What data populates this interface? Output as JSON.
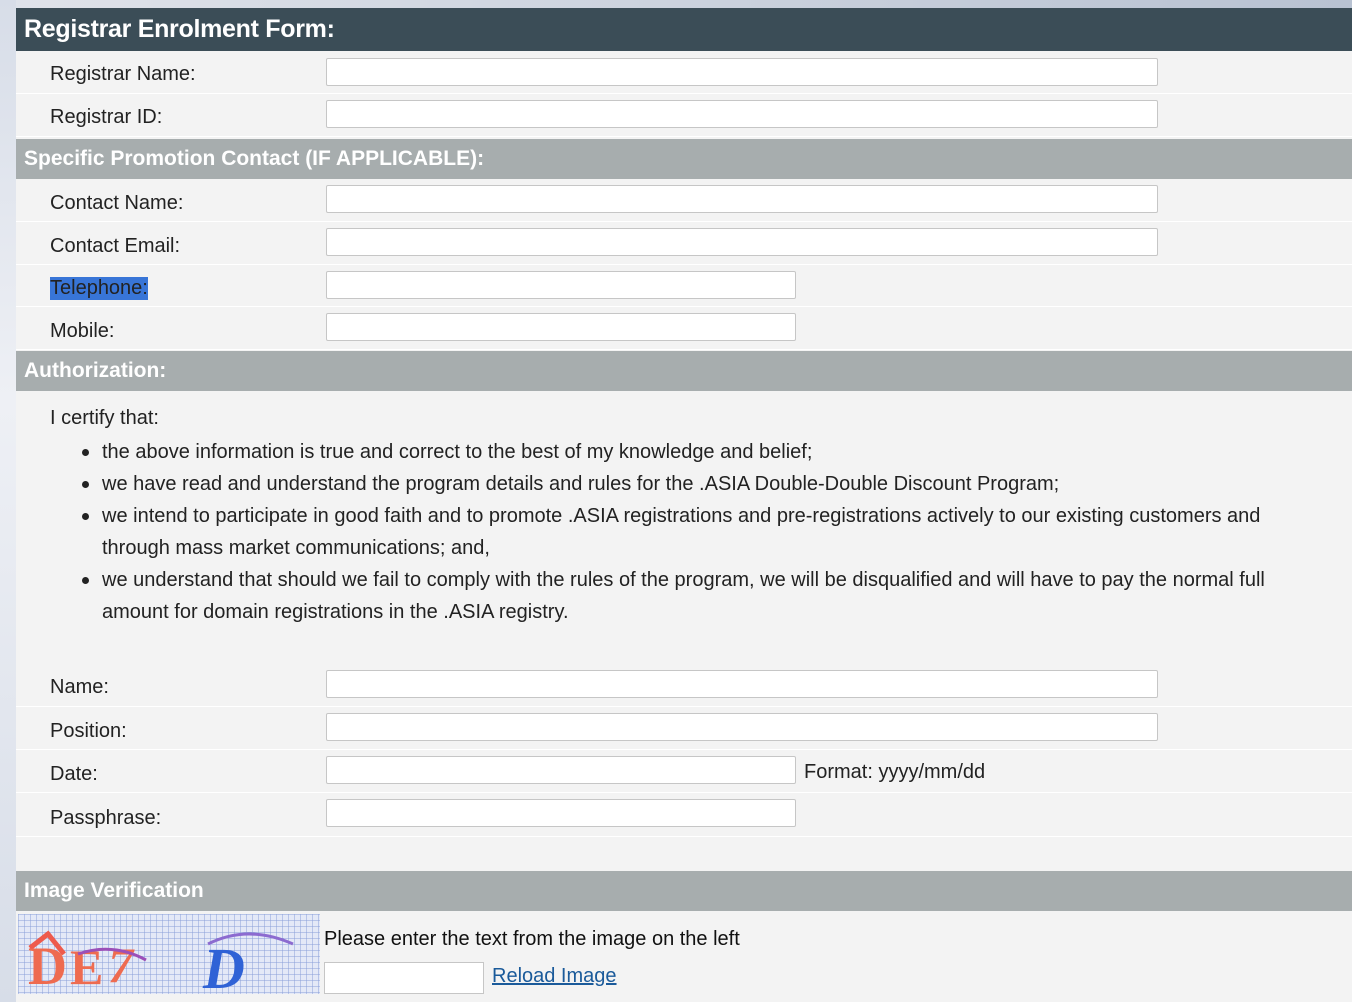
{
  "form": {
    "title": "Registrar Enrolment Form:",
    "registrar_name_label": "Registrar Name:",
    "registrar_id_label": "Registrar ID:",
    "contact_section_title": "Specific Promotion Contact (IF APPLICABLE):",
    "contact_name_label": "Contact Name:",
    "contact_email_label": "Contact Email:",
    "telephone_label": "Telephone:",
    "mobile_label": "Mobile:",
    "authorization_title": "Authorization:",
    "certify_intro": "I certify that:",
    "certify_items": [
      "the above information is true and correct to the best of my knowledge and belief;",
      "we have read and understand the program details and rules for the .ASIA Double-Double Discount Program;",
      "we intend to participate in good faith and to promote .ASIA registrations and pre-registrations actively to our existing customers and through mass market communications; and,",
      "we understand that should we fail to comply with the rules of the program, we will be disqualified and will have to pay the normal full amount for domain registrations in the .ASIA registry."
    ],
    "name_label": "Name:",
    "position_label": "Position:",
    "date_label": "Date:",
    "date_format_hint": "Format: yyyy/mm/dd",
    "passphrase_label": "Passphrase:",
    "image_verification_title": "Image Verification",
    "captcha_instruction": "Please enter the text from the image on the left",
    "reload_link": "Reload Image"
  },
  "colors": {
    "header_dark": "#3b4d57",
    "header_grey": "#a7adae",
    "selection": "#3875d7",
    "link": "#1a5a9a"
  }
}
